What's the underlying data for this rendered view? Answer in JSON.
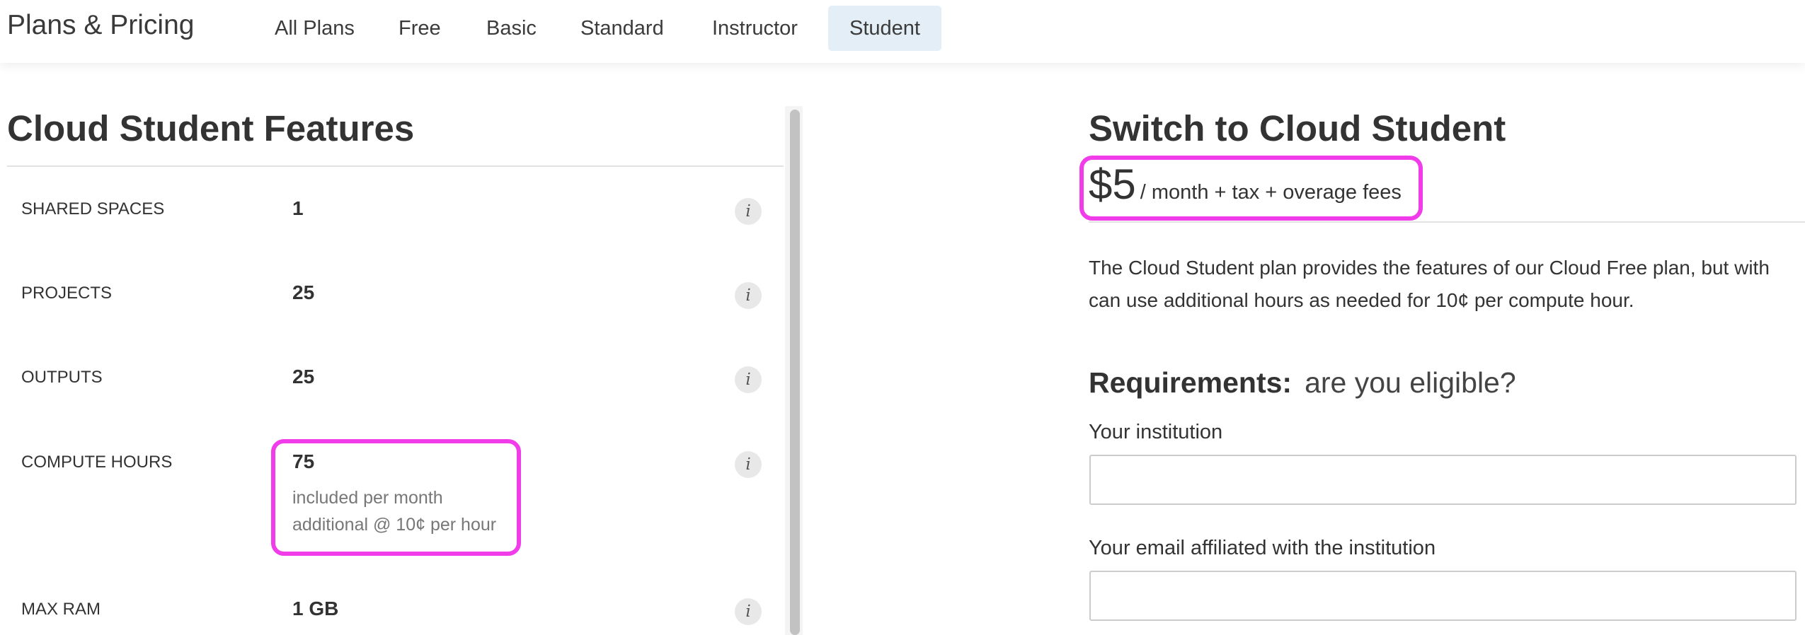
{
  "header": {
    "brand": "Plans & Pricing",
    "tabs": [
      {
        "label": "All Plans"
      },
      {
        "label": "Free"
      },
      {
        "label": "Basic"
      },
      {
        "label": "Standard"
      },
      {
        "label": "Instructor"
      },
      {
        "label": "Student",
        "active": true
      }
    ]
  },
  "features": {
    "title": "Cloud Student Features",
    "rows": [
      {
        "label": "SHARED SPACES",
        "value": "1"
      },
      {
        "label": "PROJECTS",
        "value": "25"
      },
      {
        "label": "OUTPUTS",
        "value": "25"
      },
      {
        "label": "COMPUTE HOURS",
        "value": "75",
        "sub1": "included per month",
        "sub2": "additional @ 10¢ per hour"
      },
      {
        "label": "MAX RAM",
        "value": "1 GB"
      }
    ],
    "info_glyph": "i"
  },
  "plan": {
    "title": "Switch to Cloud Student",
    "price": "$5",
    "price_suffix": "/ month + tax + overage fees",
    "description_line1": "The Cloud Student plan provides the features of our Cloud Free plan, but with",
    "description_line2": "can use additional hours as needed for 10¢ per compute hour.",
    "requirements_label": "Requirements:",
    "requirements_question": "are you eligible?",
    "institution_label": "Your institution",
    "institution_value": "",
    "email_label": "Your email affiliated with the institution",
    "email_value": ""
  },
  "colors": {
    "highlight": "#f13ce9",
    "active_tab_bg": "#e4eef6",
    "text": "#333333",
    "muted_text": "#777777"
  },
  "icons": {
    "info": "info-icon"
  }
}
